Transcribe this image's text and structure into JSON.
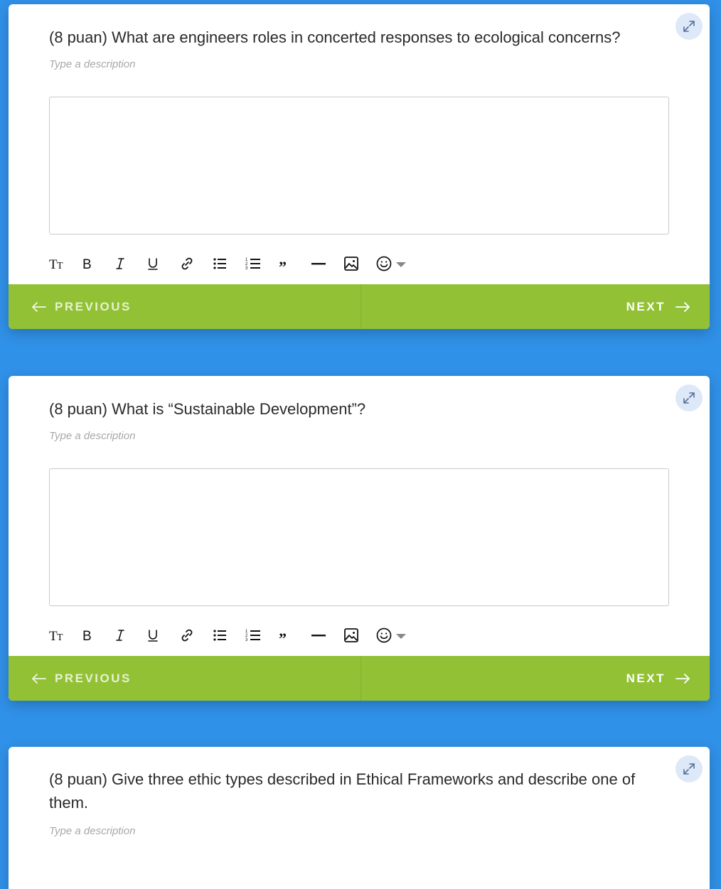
{
  "colors": {
    "page_bg": "#3091e8",
    "nav_bar": "#92c135",
    "expand_btn": "#dde8f8"
  },
  "navigation": {
    "previous_label": "PREVIOUS",
    "next_label": "NEXT"
  },
  "toolbar_icons": [
    "text-size-icon",
    "bold-icon",
    "italic-icon",
    "underline-icon",
    "link-icon",
    "bullet-list-icon",
    "numbered-list-icon",
    "quote-icon",
    "horizontal-rule-icon",
    "image-icon",
    "emoji-icon"
  ],
  "questions": [
    {
      "text": "(8 puan) What are engineers roles in concerted responses to ecological concerns?",
      "description_placeholder": "Type a description",
      "answer_value": ""
    },
    {
      "text": "(8 puan) What is “Sustainable Development”?",
      "description_placeholder": "Type a description",
      "answer_value": ""
    },
    {
      "text": "(8 puan) Give three ethic types described in Ethical Frameworks and describe one of them.",
      "description_placeholder": "Type a description"
    }
  ]
}
